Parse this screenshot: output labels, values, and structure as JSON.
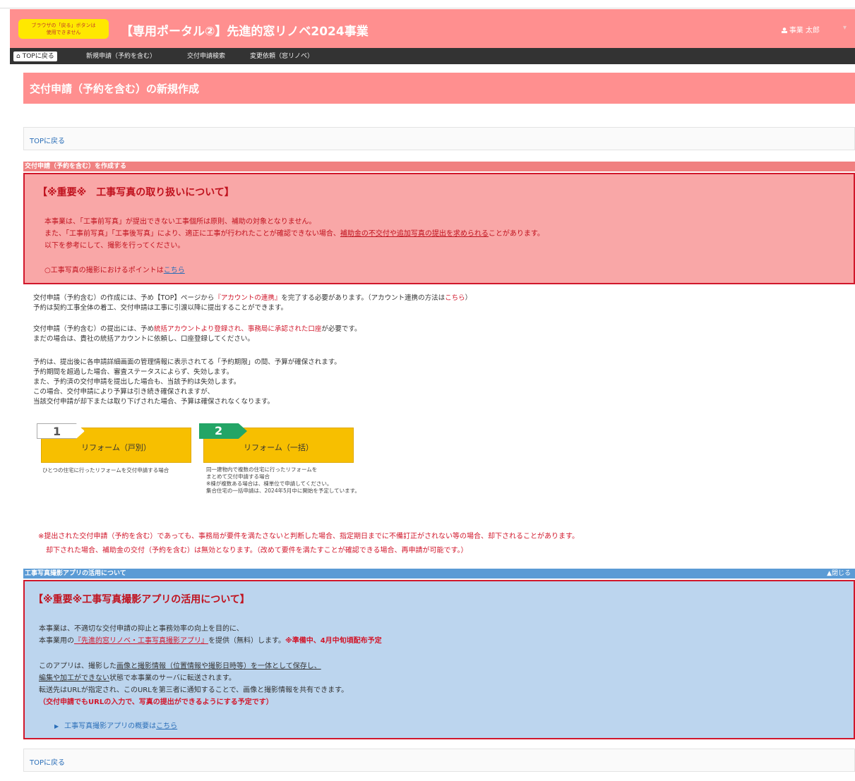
{
  "header": {
    "browser_warning_line1": "ブラウザの「戻る」ボタンは",
    "browser_warning_line2": "使用できません",
    "portal_title": "【専用ポータル②】先進的窓リノベ2024事業",
    "user_name": "事業 太郎",
    "user_caret": "▾"
  },
  "nav": {
    "home_label": "TOPに戻る",
    "items": [
      "新規申請（予約を含む）",
      "交付申請検索",
      "変更依頼（窓リノベ）"
    ]
  },
  "page": {
    "title": "交付申請（予約を含む）の新規作成",
    "top_link": "TOPに戻る"
  },
  "section_create": {
    "bar_label": "交付申請（予約を含む）を作成する",
    "notice_heading": "【※重要※　工事写真の取り扱いについて】",
    "line1": "本事業は、「工事前写真」が提出できない工事個所は原則、補助の対象となりません。",
    "line2_a": "また、「工事前写真」「工事後写真」により、適正に工事が行われたことが確認できない場合、",
    "line2_u": "補助金の不交付や追加写真の提出を求められる",
    "line2_b": "ことがあります。",
    "line3": "以下を参考にして、撮影を行ってください。",
    "point_text": "○工事写真の撮影におけるポイントは",
    "point_link": "こちら"
  },
  "info": {
    "p1a": "交付申請（予約含む）の作成には、予め【TOP】ページから",
    "p1_red": "『アカウントの連携』",
    "p1b": "を完了する必要があります。（アカウント連携の方法は",
    "p1_link": "こちら",
    "p1c": "）",
    "p2": "予約は契約工事全体の着工、交付申請は工事に引渡以降に提出することができます。",
    "p3a": "交付申請（予約含む）の提出には、予め",
    "p3_red": "統括アカウントより登録され、事務局に承認された口座",
    "p3b": "が必要です。",
    "p4": "まだの場合は、貴社の統括アカウントに依頼し、口座登録してください。",
    "p5": "予約は、提出後に各申請詳細画面の管理情報に表示されてる「予約期限」の間、予算が確保されます。",
    "p6": "予約期間を超過した場合、審査ステータスによらず、失効します。",
    "p7": "また、予約済の交付申請を提出した場合も、当該予約は失効します。",
    "p8": "この場合、交付申請により予算は引き続き確保されますが、",
    "p9": "当該交付申請が却下または取り下げされた場合、予算は確保されなくなります。"
  },
  "choices": [
    {
      "step": "1",
      "label": "リフォーム（戸別）",
      "desc": [
        "ひとつの住宅に行ったリフォームを交付申請する場合"
      ]
    },
    {
      "step": "2",
      "label": "リフォーム（一括）",
      "desc": [
        "同一建物内で複数の住宅に行ったリフォームを",
        "まとめて交付申請する場合",
        "※棟が複数ある場合は、棟単位で申請してください。",
        "集合住宅の一括申請は、2024年5月中に開始を予定しています。"
      ]
    }
  ],
  "warning": {
    "line1": "※提出された交付申請（予約を含む）であっても、事務局が要件を満たさないと判断した場合、指定期日までに不備訂正がされない等の場合、却下されることがあります。",
    "line2": "却下された場合、補助金の交付（予約を含む）は無効となります。（改めて要件を満たすことが確認できる場合、再申請が可能です。）"
  },
  "section_app": {
    "bar_label": "工事写真撮影アプリの活用について",
    "collapse_label": "▲閉じる",
    "heading": "【※重要※工事写真撮影アプリの活用について】",
    "l1": "本事業は、不適切な交付申請の抑止と事務効率の向上を目的に、",
    "l2a": "本事業用の",
    "l2_link": "『先進的窓リノベ・工事写真撮影アプリ』",
    "l2b": "を提供（無料）します。",
    "l2_red": "※準備中、4月中旬頃配布予定",
    "l3a": "このアプリは、撮影した",
    "l3_u": "画像と撮影情報（位置情報や撮影日時等）を一体として保存し、",
    "l4_u": "編集や加工ができない",
    "l4b": "状態で本事業のサーバに転送されます。",
    "l5": "転送先はURLが指定され、このURLを第三者に通知することで、画像と撮影情報を共有できます。",
    "l6_red": "（交付申請でもURLの入力で、写真の提出ができるようにする予定です）",
    "bullet_text": "工事写真撮影アプリの概要は",
    "bullet_link": "こちら"
  },
  "footer": {
    "top_link": "TOPに戻る"
  }
}
